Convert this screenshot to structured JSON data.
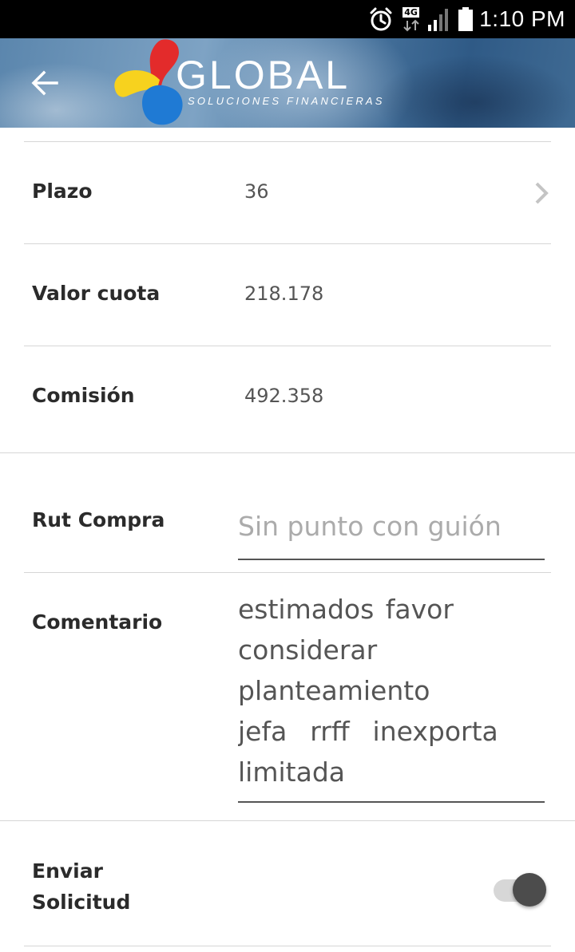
{
  "status_bar": {
    "time": "1:10 PM",
    "network_label": "4G",
    "icons": [
      "alarm-icon",
      "network-4g-icon",
      "signal-icon",
      "battery-icon"
    ]
  },
  "header": {
    "back_icon": "arrow-left-icon",
    "logo_title": "GLOBAL",
    "logo_subtitle": "SOLUCIONES FINANCIERAS",
    "logo_colors": [
      "#e32b2b",
      "#f7d21e",
      "#1f7ad4"
    ]
  },
  "details": {
    "plazo": {
      "label": "Plazo",
      "value": "36"
    },
    "valor_cuota": {
      "label": "Valor cuota",
      "value": "218.178"
    },
    "comision": {
      "label": "Comisión",
      "value": "492.358"
    }
  },
  "form": {
    "rut": {
      "label": "Rut Compra",
      "placeholder": "Sin punto con guión",
      "value": ""
    },
    "comentario": {
      "label": "Comentario",
      "value": "estimados favor\nconsiderar\nplanteamiento\njefa  rrff  inexporta\nlimitada"
    },
    "enviar": {
      "label_line1": "Enviar",
      "label_line2": "Solicitud",
      "state": "on"
    }
  },
  "colors": {
    "status_bar_bg": "#000000",
    "label_text": "#2b2b2b",
    "value_text": "#555555",
    "placeholder_text": "#ababab",
    "toggle_thumb": "#4c4c4c",
    "toggle_track": "#d7d7d7"
  }
}
